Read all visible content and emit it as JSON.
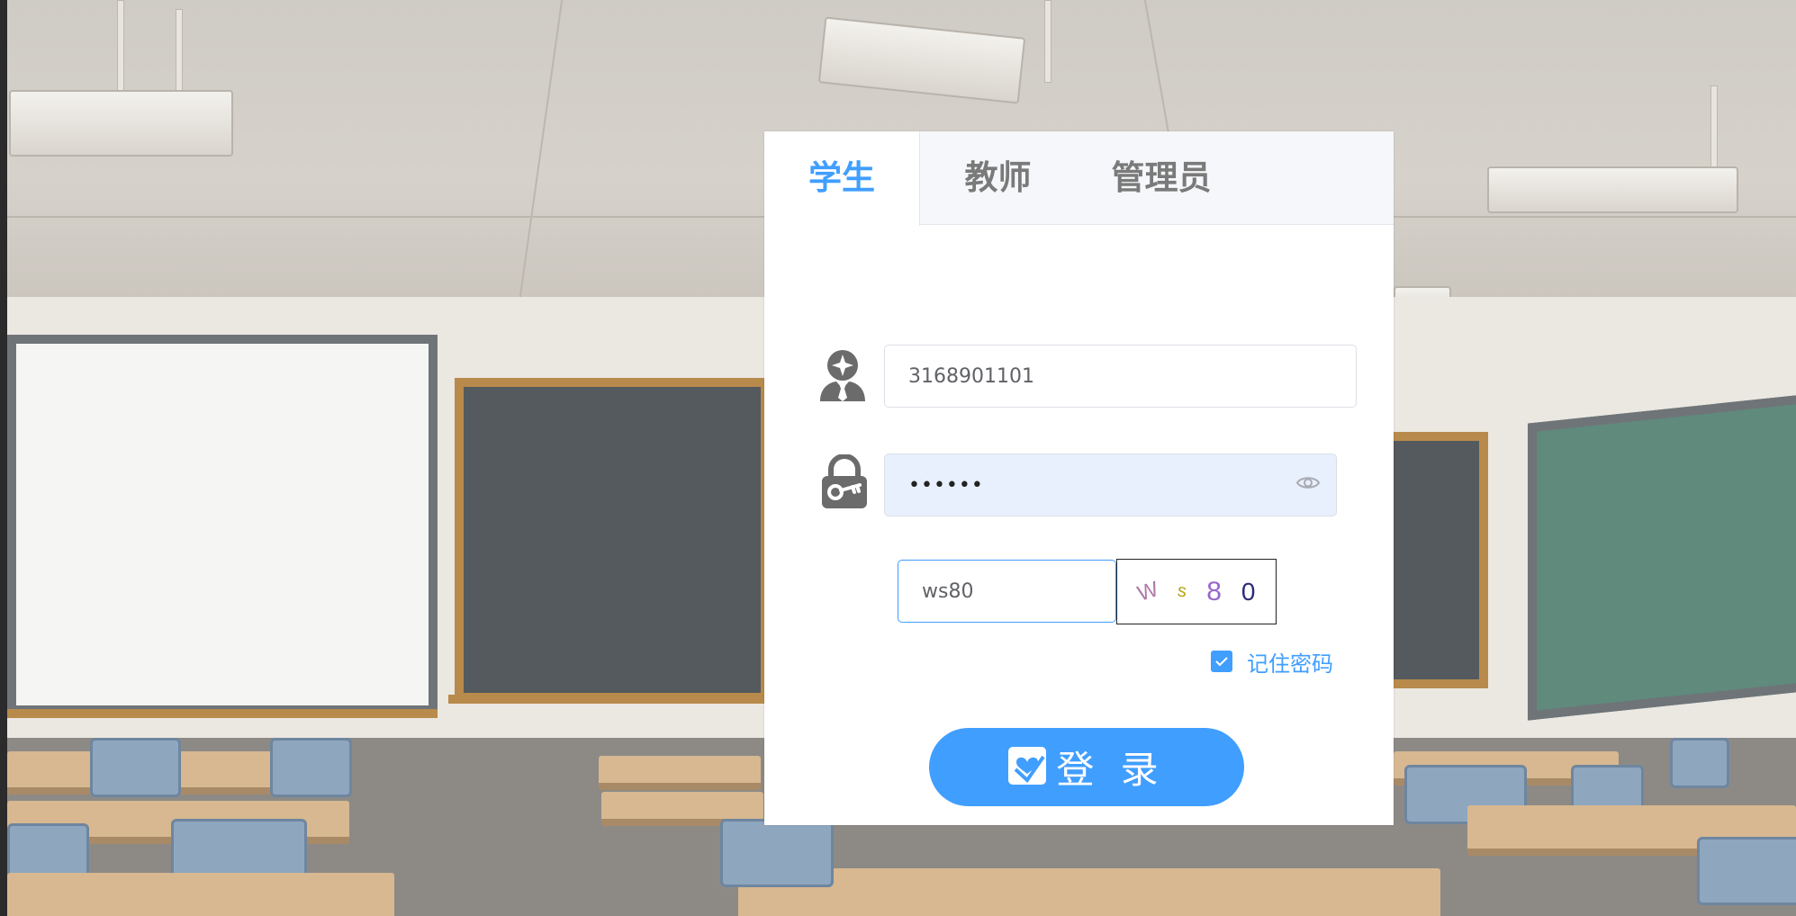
{
  "tabs": [
    {
      "label": "学生",
      "active": true
    },
    {
      "label": "教师",
      "active": false
    },
    {
      "label": "管理员",
      "active": false
    }
  ],
  "form": {
    "username_value": "3168901101",
    "password_masked": "••••••",
    "captcha_value": "ws80",
    "captcha_chars": [
      "W",
      "s",
      "8",
      "0"
    ],
    "remember_label": "记住密码",
    "remember_checked": true,
    "login_label": "登 录"
  },
  "colors": {
    "accent": "#409eff",
    "inactive_tab": "#7a7a7a",
    "autofill_bg": "#e8f0fe"
  },
  "icons": {
    "user": "student-user-icon",
    "password": "lock-key-icon",
    "eye": "eye-icon",
    "check": "checkbox-check-icon",
    "login": "heart-check-icon"
  }
}
